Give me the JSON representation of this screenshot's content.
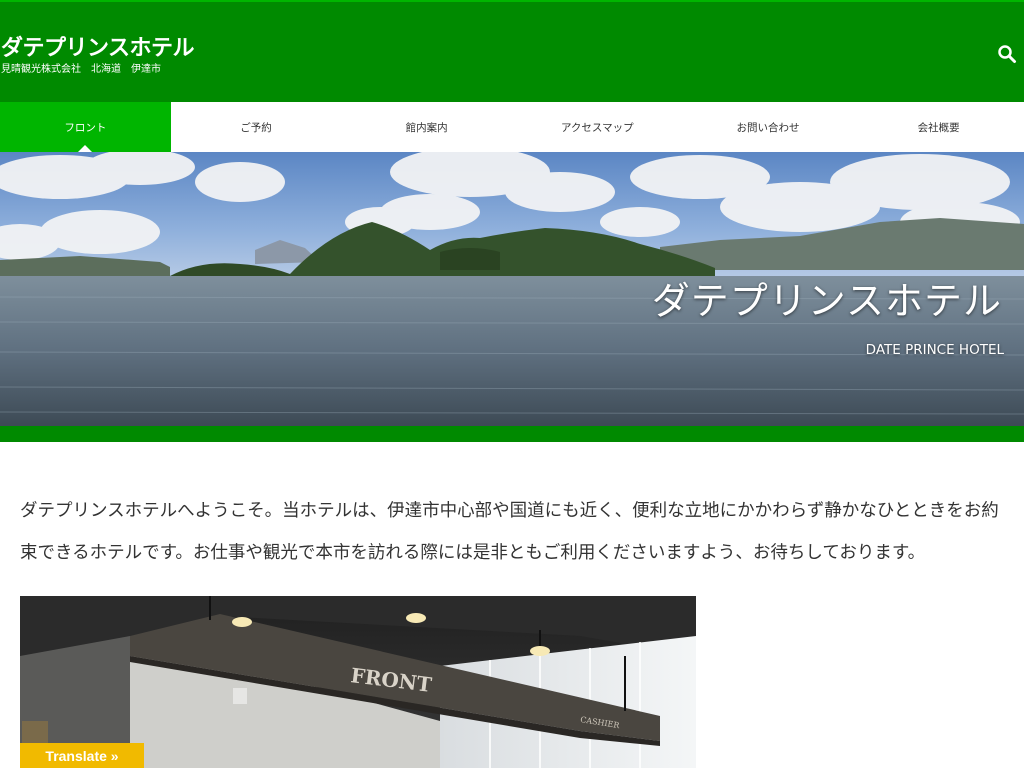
{
  "header": {
    "site_title": "ダテプリンスホテル",
    "tagline": "見晴観光株式会社　北海道　伊達市",
    "search_icon": "search-icon",
    "background_color": "#008a00"
  },
  "nav": {
    "active_color": "#00b500",
    "items": [
      {
        "label": "フロント"
      },
      {
        "label": "ご予約"
      },
      {
        "label": "館内案内"
      },
      {
        "label": "アクセスマップ"
      },
      {
        "label": "お問い合わせ"
      },
      {
        "label": "会社概要"
      }
    ]
  },
  "hero": {
    "title": "ダテプリンスホテル",
    "subtitle": "DATE PRINCE HOTEL"
  },
  "intro": {
    "text": "ダテプリンスホテルへようこそ。当ホテルは、伊達市中心部や国道にも近く、便利な立地にかかわらず静かなひとときをお約束できるホテルです。お仕事や観光で本市を訪れる際には是非ともご利用くださいますよう、お待ちしております。"
  },
  "front_photo": {
    "sign_text": "FRONT",
    "small_sign_text": "CASHIER"
  },
  "translate": {
    "label": "Translate »",
    "color": "#f1ba00"
  }
}
